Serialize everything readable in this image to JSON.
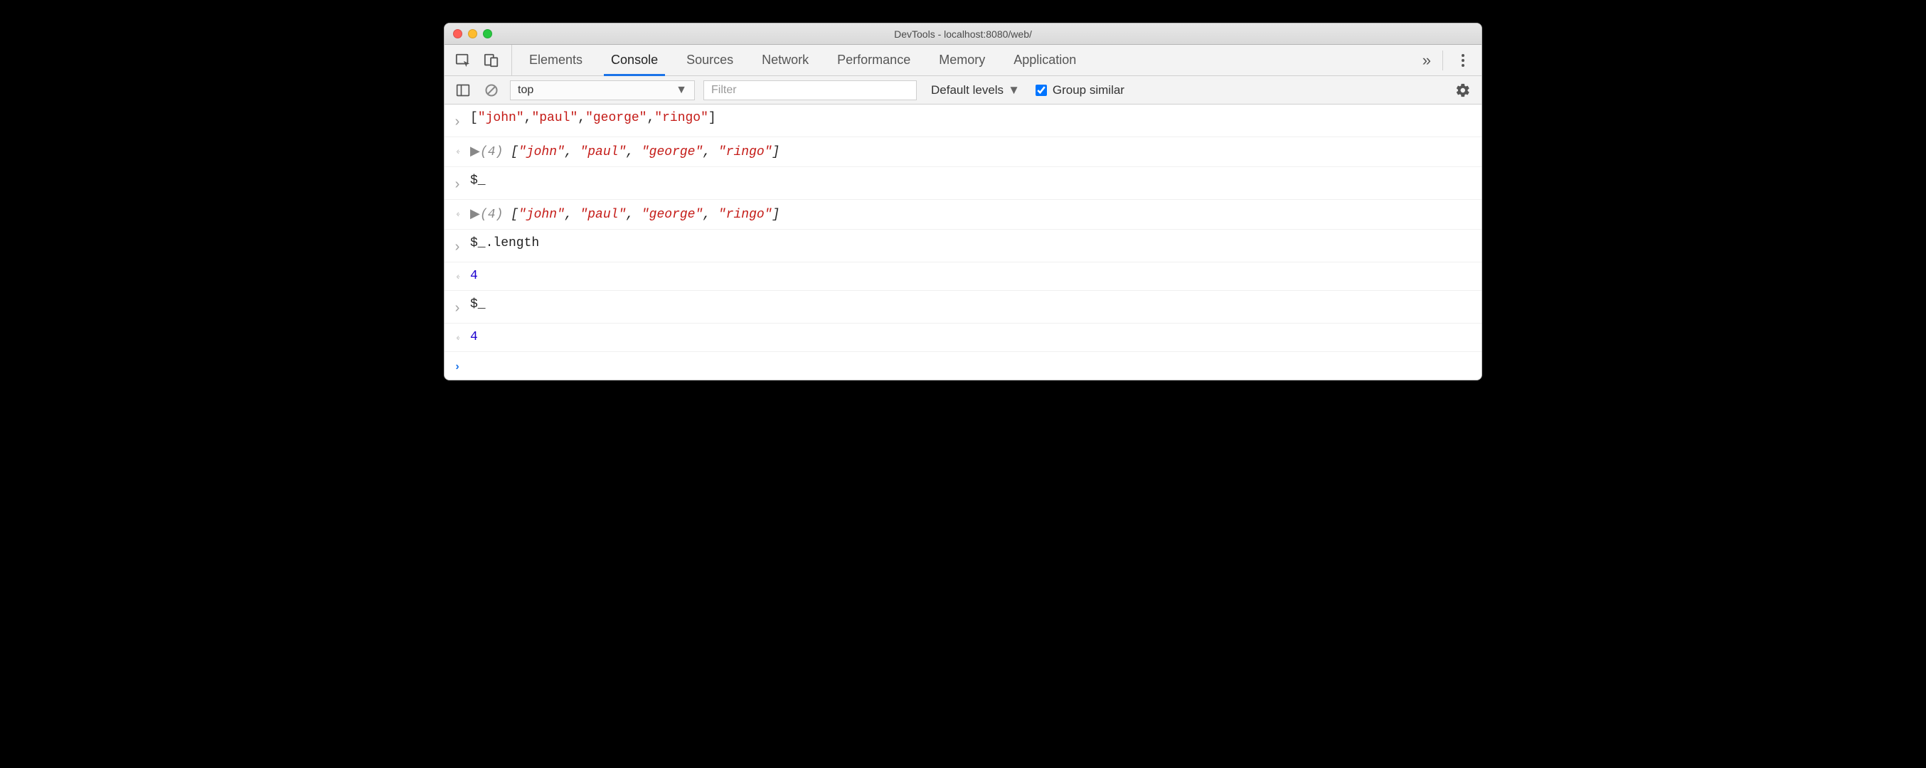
{
  "window": {
    "title": "DevTools - localhost:8080/web/"
  },
  "tabs": {
    "items": [
      "Elements",
      "Console",
      "Sources",
      "Network",
      "Performance",
      "Memory",
      "Application"
    ],
    "active_index": 1
  },
  "toolbar": {
    "context": "top",
    "filter_placeholder": "Filter",
    "levels_label": "Default levels",
    "group_similar_label": "Group similar",
    "group_similar_checked": true
  },
  "console": {
    "rows": [
      {
        "kind": "input",
        "segments": [
          {
            "t": "[",
            "c": "punct"
          },
          {
            "t": "\"john\"",
            "c": "str"
          },
          {
            "t": ",",
            "c": "punct"
          },
          {
            "t": "\"paul\"",
            "c": "str"
          },
          {
            "t": ",",
            "c": "punct"
          },
          {
            "t": "\"george\"",
            "c": "str"
          },
          {
            "t": ",",
            "c": "punct"
          },
          {
            "t": "\"ringo\"",
            "c": "str"
          },
          {
            "t": "]",
            "c": "punct"
          }
        ]
      },
      {
        "kind": "output-array",
        "count": "(4)",
        "items": [
          "\"john\"",
          "\"paul\"",
          "\"george\"",
          "\"ringo\""
        ]
      },
      {
        "kind": "input",
        "segments": [
          {
            "t": "$_",
            "c": "punct"
          }
        ]
      },
      {
        "kind": "output-array",
        "count": "(4)",
        "items": [
          "\"john\"",
          "\"paul\"",
          "\"george\"",
          "\"ringo\""
        ]
      },
      {
        "kind": "input",
        "segments": [
          {
            "t": "$_.length",
            "c": "punct"
          }
        ]
      },
      {
        "kind": "output-num",
        "value": "4"
      },
      {
        "kind": "input",
        "segments": [
          {
            "t": "$_",
            "c": "punct"
          }
        ]
      },
      {
        "kind": "output-num",
        "value": "4"
      }
    ]
  }
}
